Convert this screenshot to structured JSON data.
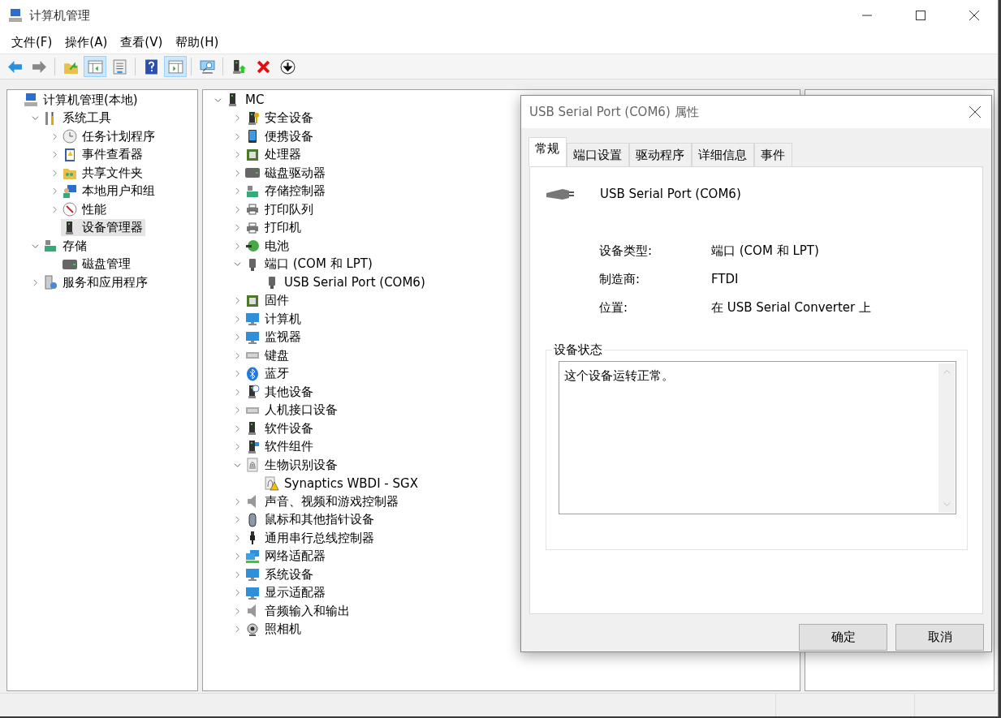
{
  "window": {
    "title": "计算机管理"
  },
  "menu": [
    "文件(F)",
    "操作(A)",
    "查看(V)",
    "帮助(H)"
  ],
  "toolbar": [
    [
      {
        "pressed": false
      },
      {
        "pressed": false
      }
    ],
    [
      {
        "pressed": false
      },
      {
        "pressed": true
      },
      {
        "pressed": false
      }
    ],
    [
      {
        "pressed": false
      },
      {
        "pressed": true
      }
    ],
    [
      {
        "pressed": false
      }
    ],
    [
      {
        "pressed": false
      },
      {
        "pressed": false
      },
      {
        "pressed": false
      }
    ]
  ],
  "navigation_tree": {
    "label": "计算机管理(本地)",
    "selected": false,
    "children": [
      {
        "label": "系统工具",
        "expanded": true,
        "selected": false,
        "children": [
          {
            "label": "任务计划程序",
            "expanded": false,
            "selected": false
          },
          {
            "label": "事件查看器",
            "expanded": false,
            "selected": false
          },
          {
            "label": "共享文件夹",
            "expanded": false,
            "selected": false
          },
          {
            "label": "本地用户和组",
            "expanded": false,
            "selected": false
          },
          {
            "label": "性能",
            "expanded": false,
            "selected": false
          },
          {
            "label": "设备管理器",
            "selected": true
          }
        ]
      },
      {
        "label": "存储",
        "expanded": true,
        "selected": false,
        "children": [
          {
            "label": "磁盘管理",
            "selected": false
          }
        ]
      },
      {
        "label": "服务和应用程序",
        "expanded": false,
        "selected": false
      }
    ]
  },
  "device_tree": {
    "label": "MC",
    "expanded": true,
    "children": [
      {
        "label": "安全设备",
        "expanded": false
      },
      {
        "label": "便携设备",
        "expanded": false
      },
      {
        "label": "处理器",
        "expanded": false
      },
      {
        "label": "磁盘驱动器",
        "expanded": false
      },
      {
        "label": "存储控制器",
        "expanded": false
      },
      {
        "label": "打印队列",
        "expanded": false
      },
      {
        "label": "打印机",
        "expanded": false
      },
      {
        "label": "电池",
        "expanded": false
      },
      {
        "label": "端口 (COM 和 LPT)",
        "expanded": true,
        "children": [
          {
            "label": "USB Serial Port (COM6)"
          }
        ]
      },
      {
        "label": "固件",
        "expanded": false
      },
      {
        "label": "计算机",
        "expanded": false
      },
      {
        "label": "监视器",
        "expanded": false
      },
      {
        "label": "键盘",
        "expanded": false
      },
      {
        "label": "蓝牙",
        "expanded": false
      },
      {
        "label": "其他设备",
        "expanded": false
      },
      {
        "label": "人机接口设备",
        "expanded": false
      },
      {
        "label": "软件设备",
        "expanded": false
      },
      {
        "label": "软件组件",
        "expanded": false
      },
      {
        "label": "生物识别设备",
        "expanded": true,
        "children": [
          {
            "label": "Synaptics WBDI - SGX"
          }
        ]
      },
      {
        "label": "声音、视频和游戏控制器",
        "expanded": false
      },
      {
        "label": "鼠标和其他指针设备",
        "expanded": false
      },
      {
        "label": "通用串行总线控制器",
        "expanded": false
      },
      {
        "label": "网络适配器",
        "expanded": false
      },
      {
        "label": "系统设备",
        "expanded": false
      },
      {
        "label": "显示适配器",
        "expanded": false
      },
      {
        "label": "音频输入和输出",
        "expanded": false
      },
      {
        "label": "照相机",
        "expanded": false
      }
    ]
  },
  "properties_dialog": {
    "title": "USB Serial Port (COM6) 属性",
    "tabs": [
      {
        "label": "常规",
        "selected": true
      },
      {
        "label": "端口设置",
        "selected": false
      },
      {
        "label": "驱动程序",
        "selected": false
      },
      {
        "label": "详细信息",
        "selected": false
      },
      {
        "label": "事件",
        "selected": false
      }
    ],
    "device_name": "USB Serial Port (COM6)",
    "properties": [
      {
        "label": "设备类型:",
        "value": "端口 (COM 和 LPT)"
      },
      {
        "label": "制造商:",
        "value": "FTDI"
      },
      {
        "label": "位置:",
        "value": "在 USB Serial Converter 上"
      }
    ],
    "status_group": {
      "title": "设备状态",
      "text": "这个设备运转正常。"
    },
    "buttons": [
      "确定",
      "取消"
    ]
  }
}
